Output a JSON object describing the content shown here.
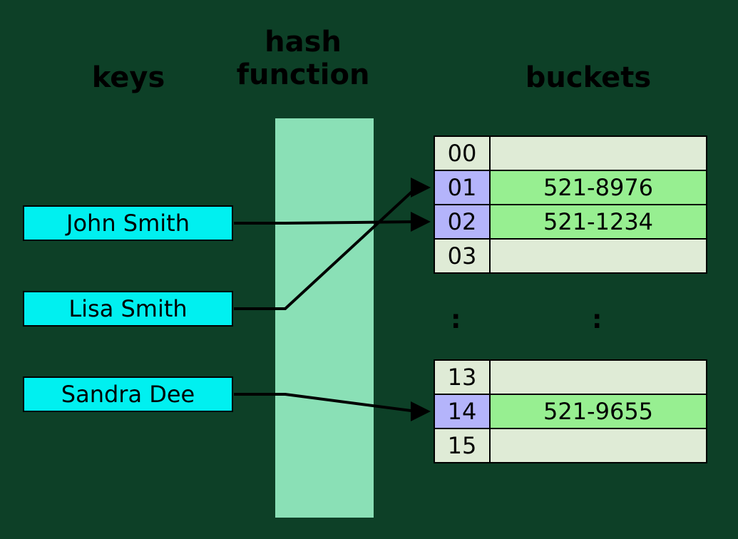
{
  "headers": {
    "keys": "keys",
    "hash": "hash\nfunction",
    "buckets": "buckets"
  },
  "keys": [
    {
      "name": "John Smith"
    },
    {
      "name": "Lisa Smith"
    },
    {
      "name": "Sandra Dee"
    }
  ],
  "buckets_top": [
    {
      "index": "00",
      "value": "",
      "hit": false
    },
    {
      "index": "01",
      "value": "521-8976",
      "hit": true
    },
    {
      "index": "02",
      "value": "521-1234",
      "hit": true
    },
    {
      "index": "03",
      "value": "",
      "hit": false
    }
  ],
  "buckets_bottom": [
    {
      "index": "13",
      "value": "",
      "hit": false
    },
    {
      "index": "14",
      "value": "521-9655",
      "hit": true
    },
    {
      "index": "15",
      "value": "",
      "hit": false
    }
  ],
  "ellipsis": ":",
  "mappings": [
    {
      "from_key": "John Smith",
      "to_index": "02"
    },
    {
      "from_key": "Lisa Smith",
      "to_index": "01"
    },
    {
      "from_key": "Sandra Dee",
      "to_index": "14"
    }
  ]
}
